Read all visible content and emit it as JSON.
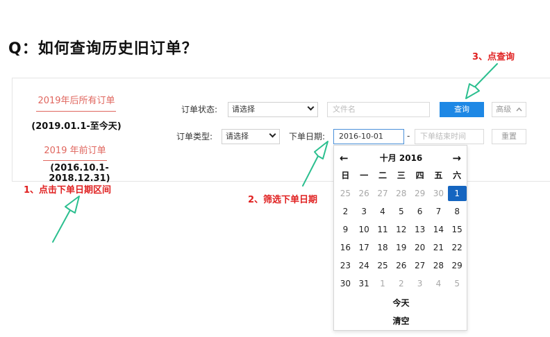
{
  "title": "Q：如何查询历史旧订单？",
  "tabs": [
    {
      "label": "2019年后所有订单",
      "range": "(2019.01.1-至今天)"
    },
    {
      "label": "2019 年前订单",
      "range": "(2016.10.1-2018.12.31)"
    }
  ],
  "filters": {
    "status_label": "订单状态:",
    "status_value": "请选择",
    "file_placeholder": "文件名",
    "type_label": "订单类型:",
    "type_value": "请选择",
    "date_label": "下单日期:",
    "start_date": "2016-10-01",
    "separator": "-",
    "end_placeholder": "下单结束时间"
  },
  "buttons": {
    "search": "查询",
    "advanced": "高级",
    "reset": "重置"
  },
  "annotations": {
    "step1": "1、点击下单日期区间",
    "step2": "2、筛选下单日期",
    "step3": "3、点查询"
  },
  "calendar": {
    "prev": "←",
    "next": "→",
    "month_title": "十月 2016",
    "weekdays": [
      "日",
      "一",
      "二",
      "三",
      "四",
      "五",
      "六"
    ],
    "weeks": [
      [
        {
          "d": "25",
          "m": true
        },
        {
          "d": "26",
          "m": true
        },
        {
          "d": "27",
          "m": true
        },
        {
          "d": "28",
          "m": true
        },
        {
          "d": "29",
          "m": true
        },
        {
          "d": "30",
          "m": true
        },
        {
          "d": "1",
          "s": true
        }
      ],
      [
        {
          "d": "2"
        },
        {
          "d": "3"
        },
        {
          "d": "4"
        },
        {
          "d": "5"
        },
        {
          "d": "6"
        },
        {
          "d": "7"
        },
        {
          "d": "8"
        }
      ],
      [
        {
          "d": "9"
        },
        {
          "d": "10"
        },
        {
          "d": "11"
        },
        {
          "d": "12"
        },
        {
          "d": "13"
        },
        {
          "d": "14"
        },
        {
          "d": "15"
        }
      ],
      [
        {
          "d": "16"
        },
        {
          "d": "17"
        },
        {
          "d": "18"
        },
        {
          "d": "19"
        },
        {
          "d": "20"
        },
        {
          "d": "21"
        },
        {
          "d": "22"
        }
      ],
      [
        {
          "d": "23"
        },
        {
          "d": "24"
        },
        {
          "d": "25"
        },
        {
          "d": "26"
        },
        {
          "d": "27"
        },
        {
          "d": "28"
        },
        {
          "d": "29"
        }
      ],
      [
        {
          "d": "30"
        },
        {
          "d": "31"
        },
        {
          "d": "1",
          "m": true
        },
        {
          "d": "2",
          "m": true
        },
        {
          "d": "3",
          "m": true
        },
        {
          "d": "4",
          "m": true
        },
        {
          "d": "5",
          "m": true
        }
      ]
    ],
    "today": "今天",
    "clear": "清空"
  },
  "colors": {
    "accent": "#1e88e5",
    "selected_day": "#1565c0",
    "tab_text": "#e0665e",
    "annotation": "#e02020",
    "arrow": "#2bbf8f"
  },
  "icons": {
    "advanced": "chevron-up-icon",
    "dropdown": "chevron-down-icon",
    "arrow": "hand-drawn-arrow-icon"
  }
}
